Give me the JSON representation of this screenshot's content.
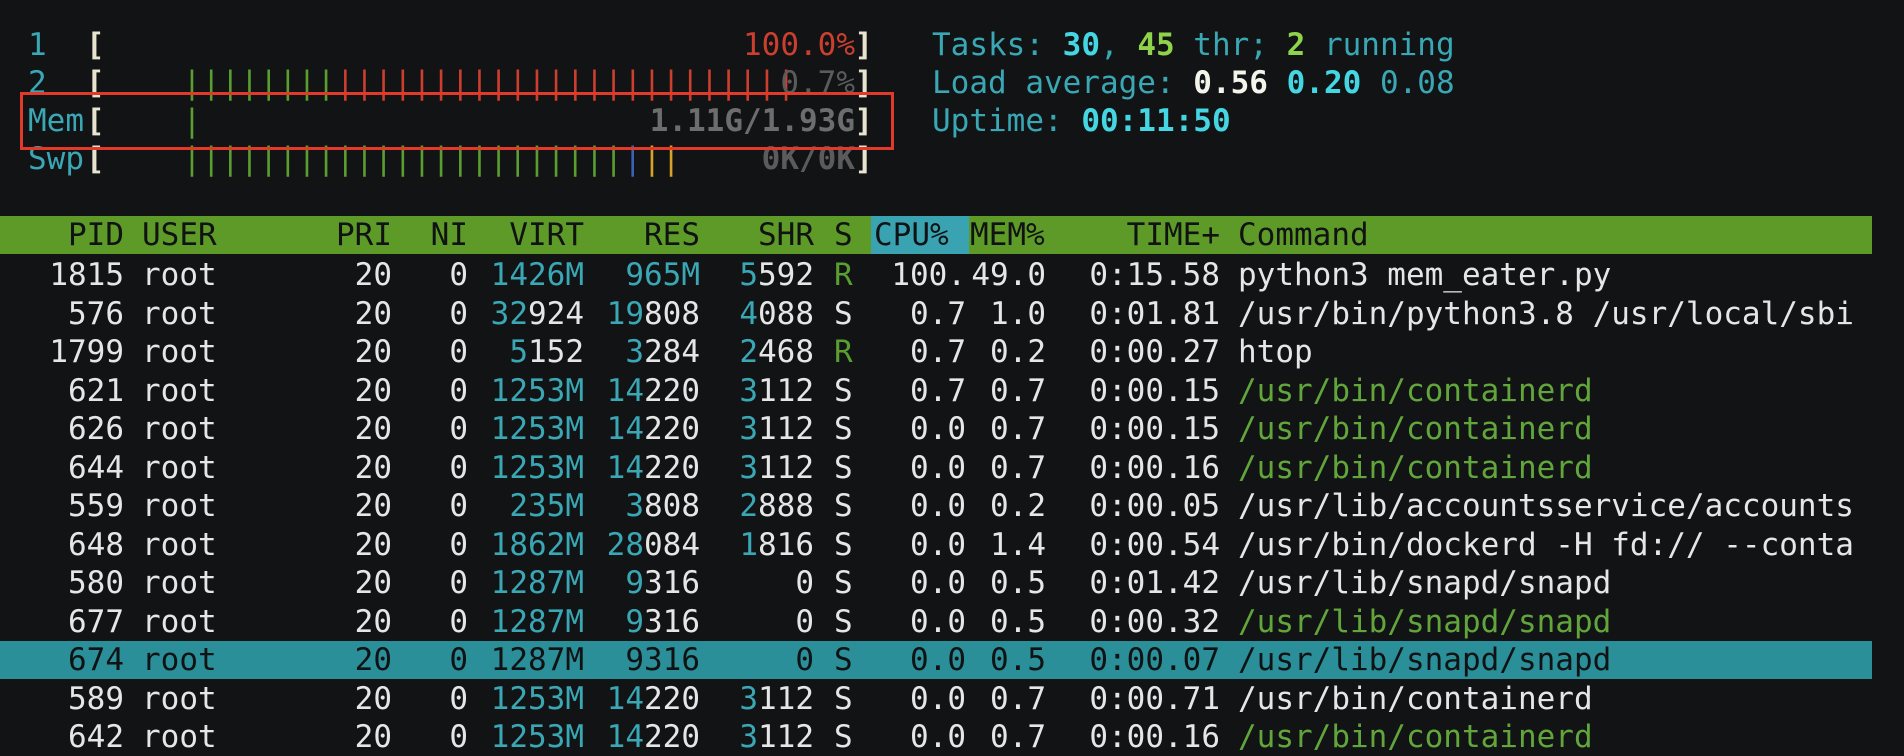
{
  "meters": [
    {
      "label": "1",
      "open": "[",
      "bars": [
        {
          "text": "|",
          "color": "#5a9e2f"
        },
        {
          "text": "|||||||",
          "color": "#5a9e2f"
        },
        {
          "text": "||||||||||||||||||||||||",
          "color": "#cc3f2f"
        }
      ],
      "value": "100.0%",
      "value_color": "#cc3f2f",
      "close": "]"
    },
    {
      "label": "2",
      "open": "[",
      "bars": [
        {
          "text": "|",
          "color": "#5a9e2f"
        }
      ],
      "value": "0.7%",
      "value_color": "#5b5b5b",
      "close": "]"
    },
    {
      "label": "Mem",
      "open": "[",
      "bars": [
        {
          "text": "|||||||||||||||||||||||",
          "color": "#5a9e2f"
        },
        {
          "text": "|",
          "color": "#3b62b7"
        },
        {
          "text": "||",
          "color": "#d8a22a"
        }
      ],
      "value": "1.11G/1.93G",
      "value_color": "#6d6d6d",
      "close": "]"
    },
    {
      "label": "Swp",
      "open": "[",
      "bars": [],
      "value": "0K/0K",
      "value_color": "#5b5b5b",
      "close": "]"
    }
  ],
  "summary": {
    "tasks_label": "Tasks: ",
    "tasks_count": "30",
    "tasks_sep": ", ",
    "threads": "45",
    "thr_label": " thr; ",
    "running": "2",
    "running_label": " running",
    "load_label": "Load average: ",
    "load_1": "0.56",
    "load_5": "0.20",
    "load_15": "0.08",
    "uptime_label": "Uptime: ",
    "uptime": "00:11:50"
  },
  "table": {
    "headers": {
      "pid": "PID",
      "user": "USER",
      "pri": "PRI",
      "ni": "NI",
      "virt": "VIRT",
      "res": "RES",
      "shr": "SHR",
      "s": "S",
      "cpu": "CPU%",
      "mem": "MEM%",
      "time": "TIME+",
      "command": "Command"
    },
    "rows": [
      {
        "pid": "1815",
        "user": "root",
        "pri": "20",
        "ni": "0",
        "virt_a": "1426M",
        "virt_b": "",
        "res_a": "965M",
        "res_b": "",
        "shr_a": "5",
        "shr_b": "592",
        "s": "R",
        "cpu": "100.",
        "mem": "49.0",
        "time": "0:15.58",
        "command": "python3 mem_eater.py",
        "cmd_green": false,
        "selected": false
      },
      {
        "pid": "576",
        "user": "root",
        "pri": "20",
        "ni": "0",
        "virt_a": "32",
        "virt_b": "924",
        "res_a": "19",
        "res_b": "808",
        "shr_a": "4",
        "shr_b": "088",
        "s": "S",
        "cpu": "0.7",
        "mem": "1.0",
        "time": "0:01.81",
        "command": "/usr/bin/python3.8 /usr/local/sbi",
        "cmd_green": false,
        "selected": false
      },
      {
        "pid": "1799",
        "user": "root",
        "pri": "20",
        "ni": "0",
        "virt_a": "5",
        "virt_b": "152",
        "res_a": "3",
        "res_b": "284",
        "shr_a": "2",
        "shr_b": "468",
        "s": "R",
        "cpu": "0.7",
        "mem": "0.2",
        "time": "0:00.27",
        "command": "htop",
        "cmd_green": false,
        "selected": false
      },
      {
        "pid": "621",
        "user": "root",
        "pri": "20",
        "ni": "0",
        "virt_a": "1253M",
        "virt_b": "",
        "res_a": "14",
        "res_b": "220",
        "shr_a": "3",
        "shr_b": "112",
        "s": "S",
        "cpu": "0.7",
        "mem": "0.7",
        "time": "0:00.15",
        "command": "/usr/bin/containerd",
        "cmd_green": true,
        "selected": false
      },
      {
        "pid": "626",
        "user": "root",
        "pri": "20",
        "ni": "0",
        "virt_a": "1253M",
        "virt_b": "",
        "res_a": "14",
        "res_b": "220",
        "shr_a": "3",
        "shr_b": "112",
        "s": "S",
        "cpu": "0.0",
        "mem": "0.7",
        "time": "0:00.15",
        "command": "/usr/bin/containerd",
        "cmd_green": true,
        "selected": false
      },
      {
        "pid": "644",
        "user": "root",
        "pri": "20",
        "ni": "0",
        "virt_a": "1253M",
        "virt_b": "",
        "res_a": "14",
        "res_b": "220",
        "shr_a": "3",
        "shr_b": "112",
        "s": "S",
        "cpu": "0.0",
        "mem": "0.7",
        "time": "0:00.16",
        "command": "/usr/bin/containerd",
        "cmd_green": true,
        "selected": false
      },
      {
        "pid": "559",
        "user": "root",
        "pri": "20",
        "ni": "0",
        "virt_a": "235M",
        "virt_b": "",
        "res_a": "3",
        "res_b": "808",
        "shr_a": "2",
        "shr_b": "888",
        "s": "S",
        "cpu": "0.0",
        "mem": "0.2",
        "time": "0:00.05",
        "command": "/usr/lib/accountsservice/accounts",
        "cmd_green": false,
        "selected": false
      },
      {
        "pid": "648",
        "user": "root",
        "pri": "20",
        "ni": "0",
        "virt_a": "1862M",
        "virt_b": "",
        "res_a": "28",
        "res_b": "084",
        "shr_a": "1",
        "shr_b": "816",
        "s": "S",
        "cpu": "0.0",
        "mem": "1.4",
        "time": "0:00.54",
        "command": "/usr/bin/dockerd -H fd:// --conta",
        "cmd_green": false,
        "selected": false
      },
      {
        "pid": "580",
        "user": "root",
        "pri": "20",
        "ni": "0",
        "virt_a": "1287M",
        "virt_b": "",
        "res_a": "9",
        "res_b": "316",
        "shr_a": "",
        "shr_b": "0",
        "s": "S",
        "cpu": "0.0",
        "mem": "0.5",
        "time": "0:01.42",
        "command": "/usr/lib/snapd/snapd",
        "cmd_green": false,
        "selected": false
      },
      {
        "pid": "677",
        "user": "root",
        "pri": "20",
        "ni": "0",
        "virt_a": "1287M",
        "virt_b": "",
        "res_a": "9",
        "res_b": "316",
        "shr_a": "",
        "shr_b": "0",
        "s": "S",
        "cpu": "0.0",
        "mem": "0.5",
        "time": "0:00.32",
        "command": "/usr/lib/snapd/snapd",
        "cmd_green": true,
        "selected": false
      },
      {
        "pid": "674",
        "user": "root",
        "pri": "20",
        "ni": "0",
        "virt_a": "1287M",
        "virt_b": "",
        "res_a": "9",
        "res_b": "316",
        "shr_a": "",
        "shr_b": "0",
        "s": "S",
        "cpu": "0.0",
        "mem": "0.5",
        "time": "0:00.07",
        "command": "/usr/lib/snapd/snapd",
        "cmd_green": false,
        "selected": true
      },
      {
        "pid": "589",
        "user": "root",
        "pri": "20",
        "ni": "0",
        "virt_a": "1253M",
        "virt_b": "",
        "res_a": "14",
        "res_b": "220",
        "shr_a": "3",
        "shr_b": "112",
        "s": "S",
        "cpu": "0.0",
        "mem": "0.7",
        "time": "0:00.71",
        "command": "/usr/bin/containerd",
        "cmd_green": false,
        "selected": false
      },
      {
        "pid": "642",
        "user": "root",
        "pri": "20",
        "ni": "0",
        "virt_a": "1253M",
        "virt_b": "",
        "res_a": "14",
        "res_b": "220",
        "shr_a": "3",
        "shr_b": "112",
        "s": "S",
        "cpu": "0.0",
        "mem": "0.7",
        "time": "0:00.16",
        "command": "/usr/bin/containerd",
        "cmd_green": true,
        "selected": false
      }
    ]
  }
}
